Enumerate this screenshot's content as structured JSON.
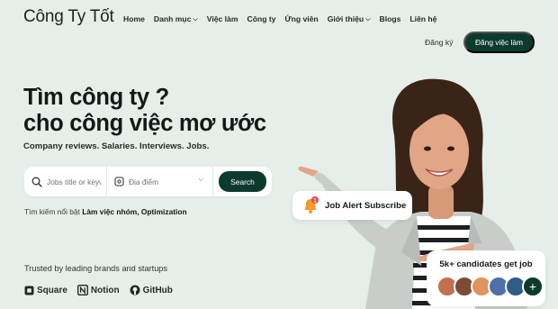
{
  "brand": {
    "logo_text": "Công Ty Tốt"
  },
  "nav": {
    "items": [
      {
        "label": "Home",
        "has_dropdown": false
      },
      {
        "label": "Danh mục",
        "has_dropdown": true
      },
      {
        "label": "Việc làm",
        "has_dropdown": false
      },
      {
        "label": "Công ty",
        "has_dropdown": false
      },
      {
        "label": "Ứng viên",
        "has_dropdown": false
      },
      {
        "label": "Giới thiệu",
        "has_dropdown": true
      },
      {
        "label": "Blogs",
        "has_dropdown": false
      },
      {
        "label": "Liên hệ",
        "has_dropdown": false
      }
    ],
    "login_label": "Đăng ký",
    "post_job_label": "Đăng việc làm"
  },
  "hero": {
    "title_line1": "Tìm công ty ?",
    "title_line2": "cho công việc mơ ước",
    "subtitle": "Company reviews. Salaries. Interviews. Jobs."
  },
  "search": {
    "keyword_placeholder": "Jobs title or keyword",
    "location_placeholder": "Địa điểm",
    "button_label": "Search"
  },
  "popular": {
    "prefix": "Tìm kiếm nổi bật",
    "tags": [
      "Làm việc nhóm,",
      "Optimization"
    ]
  },
  "trusted": {
    "text": "Trusted by leading brands and startups",
    "brands": [
      "Square",
      "Notion",
      "GitHub"
    ]
  },
  "alert_card": {
    "label": "Job Alert Subscribe",
    "badge_count": "1"
  },
  "candidates_card": {
    "label": "5k+ candidates get job",
    "add_symbol": "+"
  },
  "colors": {
    "background": "#e6eee9",
    "primary": "#0c3b2e",
    "alert_orange": "#f39a2b",
    "alert_badge": "#e5484d"
  }
}
